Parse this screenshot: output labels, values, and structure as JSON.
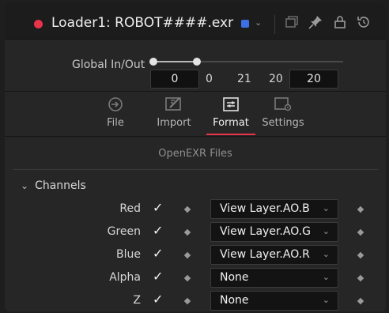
{
  "header": {
    "title": "Loader1: ROBOT####.exr",
    "chevron": "⌄",
    "icons": [
      "record-icon",
      "color-swatch",
      "versions-icon",
      "pin-icon",
      "lock-icon",
      "reset-icon"
    ]
  },
  "global_in_out": {
    "label": "Global In/Out",
    "values": [
      "0",
      "0",
      "21",
      "20",
      "20"
    ]
  },
  "tabs": [
    {
      "label": "File",
      "icon": "file-icon"
    },
    {
      "label": "Import",
      "icon": "import-icon"
    },
    {
      "label": "Format",
      "icon": "format-icon",
      "active": true
    },
    {
      "label": "Settings",
      "icon": "settings-icon"
    }
  ],
  "section_title": "OpenEXR Files",
  "channels": {
    "header": "Channels",
    "chevron": "⌄",
    "check": "✓",
    "rows": [
      {
        "label": "Red",
        "value": "View Layer.AO.B",
        "chevron": "⌄"
      },
      {
        "label": "Green",
        "value": "View Layer.AO.G",
        "chevron": "⌄"
      },
      {
        "label": "Blue",
        "value": "View Layer.AO.R",
        "chevron": "⌄"
      },
      {
        "label": "Alpha",
        "value": "None",
        "chevron": "⌄"
      },
      {
        "label": "Z",
        "value": "None",
        "chevron": "⌄"
      }
    ]
  },
  "colors": {
    "accent": "#e8334a",
    "swatch": "#3b6fe8",
    "panel": "#262627"
  }
}
